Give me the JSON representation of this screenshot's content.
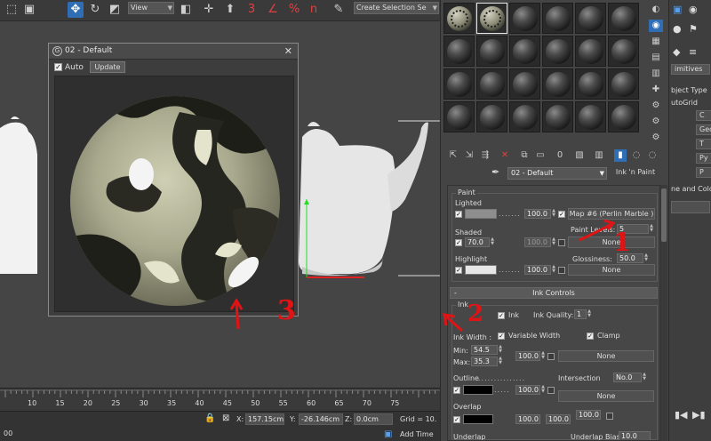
{
  "toolbar": {
    "view_select": "View",
    "selection_set": "Create Selection Se",
    "snap_label": "3",
    "percent_snap": "%",
    "angle_snap": "n"
  },
  "render_window": {
    "title": "02 - Default",
    "auto_label": "Auto",
    "update_button": "Update"
  },
  "timeline": {
    "ticks": [
      "10",
      "15",
      "20",
      "25",
      "30",
      "35",
      "40",
      "45",
      "50",
      "55",
      "60",
      "65",
      "70",
      "75"
    ]
  },
  "statusbar": {
    "left_text": "00",
    "x_label": "X:",
    "x_value": "157.15cm",
    "y_label": "Y:",
    "y_value": "-26.146cm",
    "z_label": "Z:",
    "z_value": "0.0cm",
    "grid_label": "Grid = 10.",
    "add_time_tag": "Add Time"
  },
  "material_editor": {
    "material_name": "02 - Default",
    "material_type": "Ink 'n Paint",
    "paint_rollout": {
      "group_label": "Paint",
      "lighted_label": "Lighted",
      "lighted_amount": "100.0",
      "lighted_map": "Map #6  (Perlin Marble )",
      "paint_levels_label": "Paint Levels:",
      "paint_levels_value": "5",
      "shaded_label": "Shaded",
      "shaded_value": "70.0",
      "shaded_amount": "100.0",
      "shaded_map": "None",
      "highlight_label": "Highlight",
      "highlight_amount": "100.0",
      "glossiness_label": "Glossiness:",
      "glossiness_value": "50.0",
      "highlight_map": "None"
    },
    "ink_rollout": {
      "title": "Ink Controls",
      "group_label": "Ink",
      "ink_label": "Ink",
      "ink_quality_label": "Ink Quality:",
      "ink_quality_value": "1",
      "ink_width_label": "Ink Width :",
      "variable_width_label": "Variable Width",
      "clamp_label": "Clamp",
      "min_label": "Min:",
      "min_value": "54.5",
      "max_label": "Max:",
      "max_value": "35.3",
      "width_amount": "100.0",
      "width_map": "None",
      "outline_label": "Outline",
      "outline_amount": "100.0",
      "intersection_label": "Intersection",
      "intersection_value": "No.0",
      "outline_map": "None",
      "overlap_label": "Overlap",
      "overlap_amount_1": "100.0",
      "overlap_amount_2": "100.0",
      "overlap_amount_3": "100.0",
      "underlap_label": "Underlap",
      "underlap_bias_label": "Underlap Bias:",
      "underlap_bias_value": "10.0"
    }
  },
  "command_panel": {
    "primitives": "imitives",
    "object_type": "bject Type",
    "autogrid": "utoGrid",
    "color_label": "ne and Colo",
    "buttons": [
      "C",
      "Geo",
      "T",
      "Py",
      "P"
    ]
  },
  "annotations": {
    "one": "1",
    "two": "2",
    "three": "3"
  }
}
